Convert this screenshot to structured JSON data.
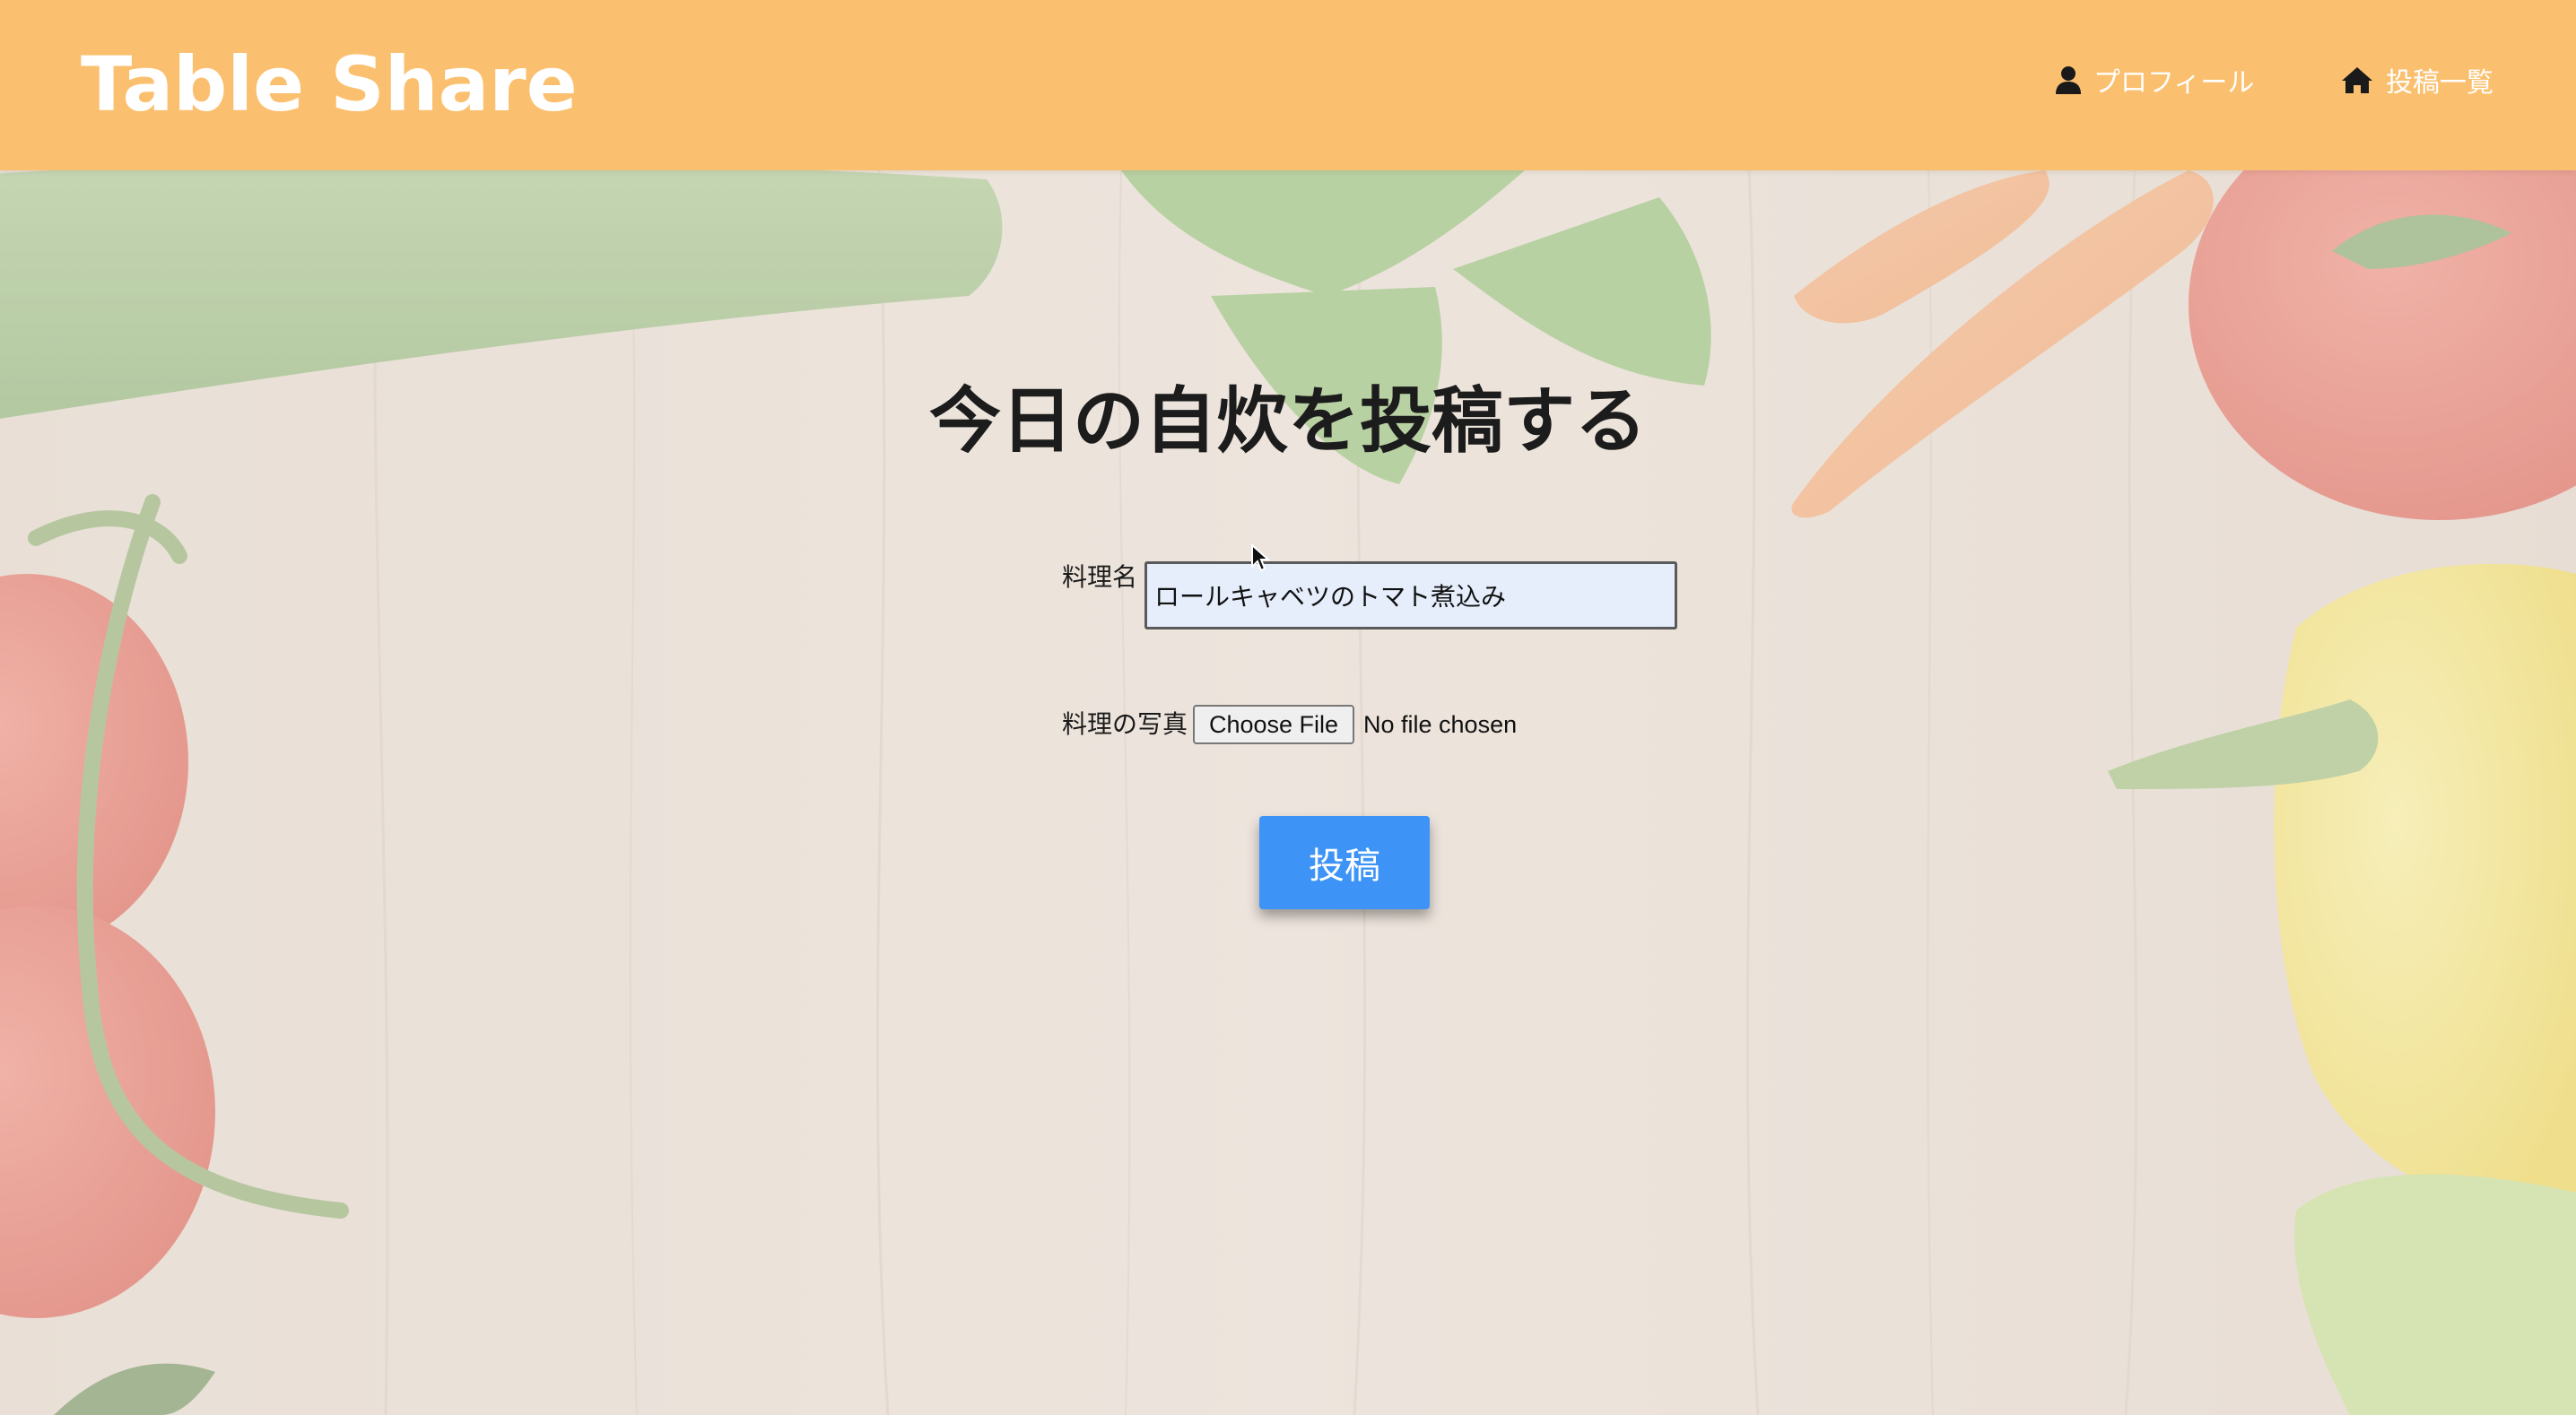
{
  "header": {
    "logo": "Table Share",
    "nav": [
      {
        "label": "プロフィール",
        "icon": "user-icon"
      },
      {
        "label": "投稿一覧",
        "icon": "home-icon"
      }
    ]
  },
  "form": {
    "title": "今日の自炊を投稿する",
    "dish_name_label": "料理名",
    "dish_name_value": "ロールキャベツのトマト煮込み",
    "photo_label": "料理の写真",
    "file_button_label": "Choose File",
    "file_status": "No file chosen",
    "submit_label": "投稿"
  },
  "colors": {
    "header_bg": "#fbc06f",
    "submit_bg": "#3d94f6",
    "input_bg": "#e6eefc"
  }
}
